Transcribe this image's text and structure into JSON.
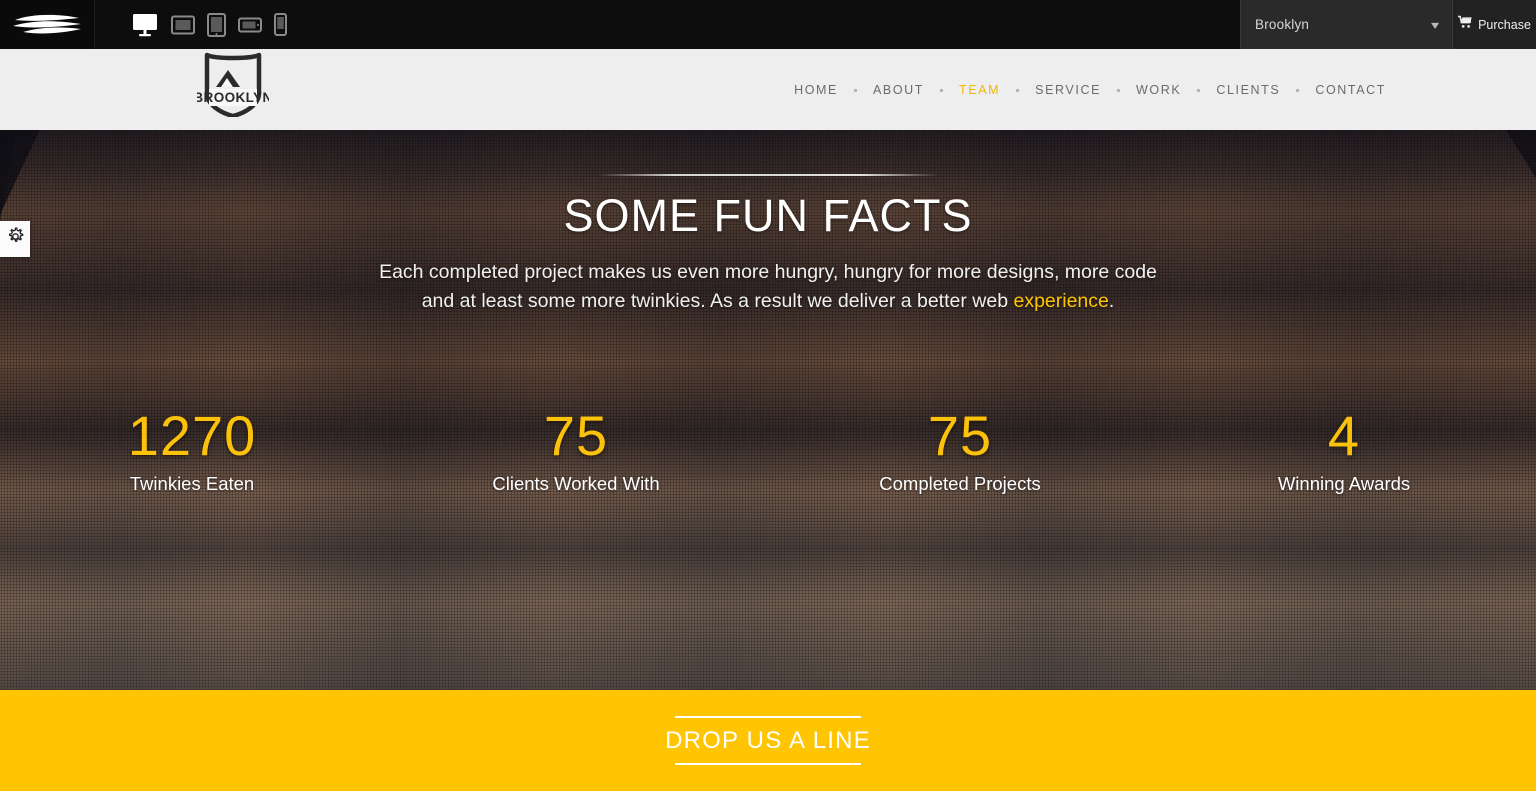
{
  "topbar": {
    "envato_logo_name": "envato-wave-logo",
    "devices": [
      {
        "name": "desktop",
        "label": "Desktop",
        "active": true
      },
      {
        "name": "tablet-landscape",
        "label": "Tablet Landscape",
        "active": false
      },
      {
        "name": "tablet-portrait",
        "label": "Tablet Portrait",
        "active": false
      },
      {
        "name": "phone-landscape",
        "label": "Phone Landscape",
        "active": false
      },
      {
        "name": "phone-portrait",
        "label": "Phone Portrait",
        "active": false
      }
    ],
    "theme_select": {
      "selected": "Brooklyn",
      "options": [
        "Brooklyn"
      ],
      "caret": "chevron-down-icon"
    },
    "purchase": {
      "label": "Purchase",
      "icon": "shopping-cart-icon"
    }
  },
  "header": {
    "brand": {
      "name": "Brooklyn",
      "label": "BROOKLYN",
      "icon": "shield-mountain-logo"
    },
    "nav": [
      {
        "label": "HOME",
        "active": false
      },
      {
        "label": "ABOUT",
        "active": false
      },
      {
        "label": "TEAM",
        "active": true
      },
      {
        "label": "SERVICE",
        "active": false
      },
      {
        "label": "WORK",
        "active": false
      },
      {
        "label": "CLIENTS",
        "active": false
      },
      {
        "label": "CONTACT",
        "active": false
      }
    ]
  },
  "settings_tab": {
    "icon": "gear-icon",
    "label": "Settings"
  },
  "hero": {
    "title": "SOME FUN FACTS",
    "description_part1": "Each completed project makes us even more hungry, hungry for more designs, more code and at least some more twinkies. As a result we deliver a better web ",
    "description_accent": "experience",
    "description_part3": ".",
    "counters": [
      {
        "number": "1270",
        "label": "Twinkies Eaten"
      },
      {
        "number": "75",
        "label": "Clients Worked With"
      },
      {
        "number": "75",
        "label": "Completed Projects"
      },
      {
        "number": "4",
        "label": "Winning Awards"
      }
    ]
  },
  "cta": {
    "label": "DROP US A LINE"
  },
  "colors": {
    "accent_yellow": "#ffc502",
    "counter_yellow": "#fcc10a",
    "nav_active": "#f2b705",
    "topbar_bg": "#0d0d0d",
    "header_bg": "#f8f8f8",
    "nav_text": "#6b6b6b"
  }
}
